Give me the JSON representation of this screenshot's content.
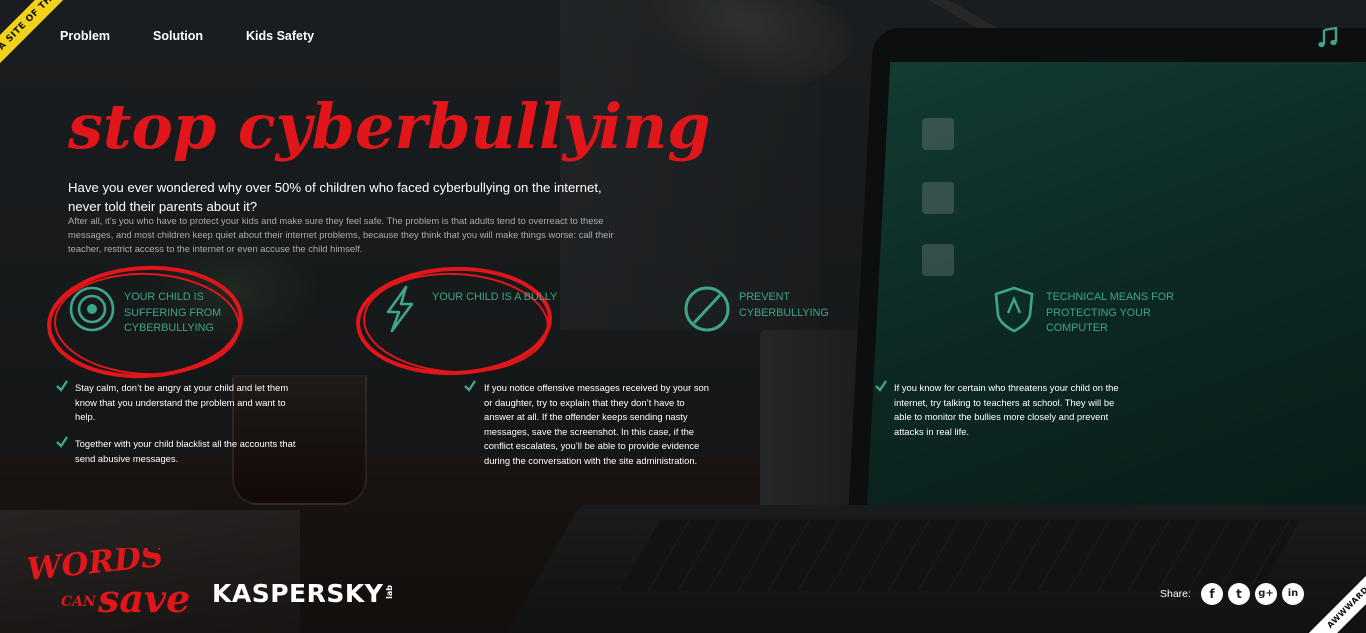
{
  "badges": {
    "fwa": "FWA SITE OF THE DAY",
    "awwwards": "AWWWARDS SOTD"
  },
  "nav": {
    "problem": "Problem",
    "solution": "Solution",
    "kids_safety": "Kids Safety"
  },
  "hero": {
    "title": "stop cyberbullying",
    "lead": "Have you ever wondered why over 50% of children who faced cyberbullying on the internet, never told their parents about it?",
    "body": "After all, it’s you who have to protect your kids and make sure they feel safe. The problem is that adults tend to overreact to these messages, and most children keep quiet about their internet problems, because they think that you will make things worse: call their teacher, restrict access to the internet or even accuse the child himself."
  },
  "features": [
    {
      "label": "YOUR CHILD IS SUFFERING FROM CYBERBULLYING",
      "icon": "target-icon"
    },
    {
      "label": "YOUR CHILD IS A BULLY",
      "icon": "lightning-icon"
    },
    {
      "label": "PREVENT CYBERBULLYING",
      "icon": "prohibited-icon"
    },
    {
      "label": "TECHNICAL MEANS FOR PROTECTING YOUR COMPUTER",
      "icon": "shield-icon"
    }
  ],
  "tips": {
    "col1": [
      "Stay calm, don’t be angry at your child and let them know that you understand the problem and want to help.",
      "Together with your child blacklist all the accounts that send abusive messages."
    ],
    "col2": [
      "If you notice offensive messages received by your son or daughter, try to explain that they don’t have to answer at all. If the offender keeps sending nasty messages, save the screenshot. In this case, if the conflict escalates, you’ll be able to provide evidence during the conversation with the site administration."
    ],
    "col3": [
      "If you know for certain who threatens your child on the internet, try talking to teachers at school. They will be able to monitor the bullies more closely and prevent attacks in real life."
    ]
  },
  "footer": {
    "words": "WORDS",
    "can": "CAN",
    "save": "save",
    "kaspersky": "KASPERSKY",
    "lab": "lab",
    "share_label": "Share:",
    "social": {
      "facebook": "f",
      "twitter": "t",
      "googleplus": "g+",
      "linkedin": "in"
    }
  },
  "colors": {
    "accent_red": "#e0161a",
    "teal": "#3fa58a",
    "badge_yellow": "#f2d21b"
  }
}
